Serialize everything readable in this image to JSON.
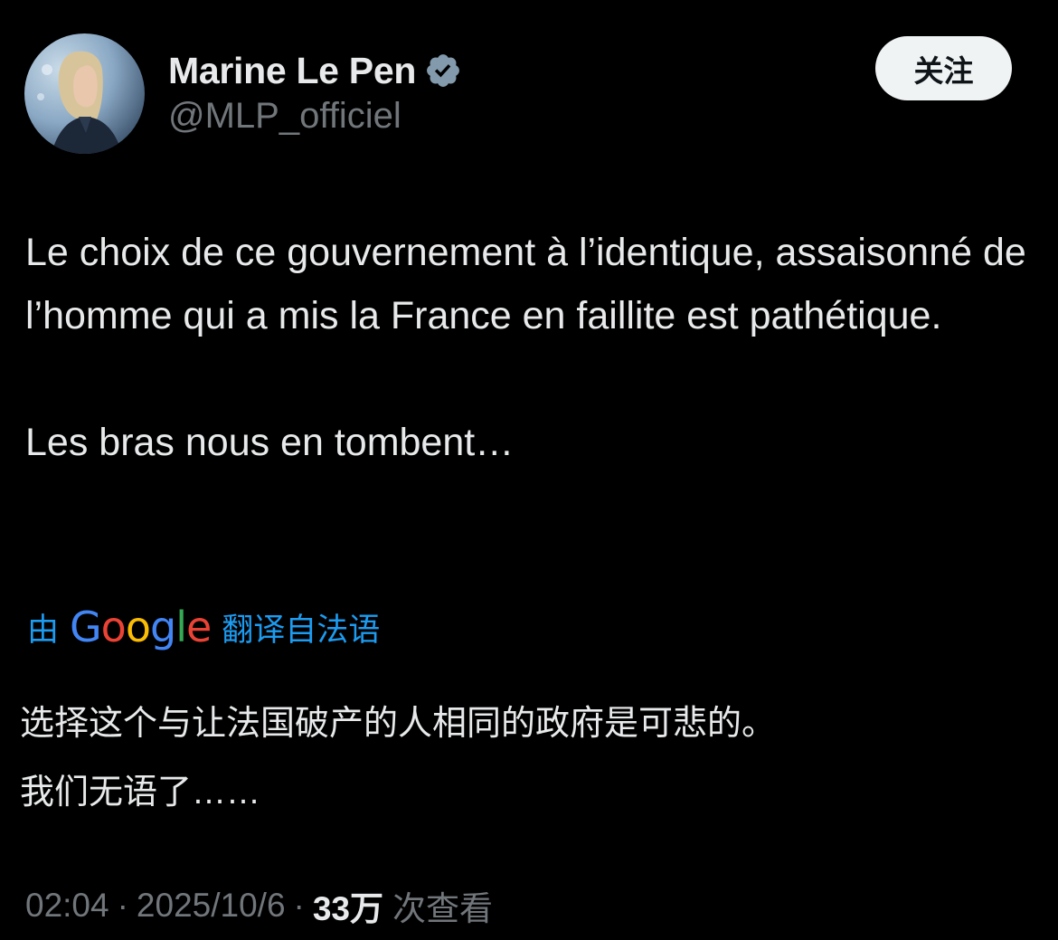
{
  "author": {
    "display_name": "Marine Le Pen",
    "handle": "@MLP_officiel",
    "verified_icon": "verified-badge-icon",
    "verified_color": "#829aab"
  },
  "follow_button": {
    "label": "关注"
  },
  "tweet": {
    "paragraphs": [
      "Le choix de ce gouvernement à l’identique, assaisonné de l’homme qui a mis la France en faillite est pathétique.",
      "Les bras nous en tombent…"
    ]
  },
  "translation": {
    "prefix": "由",
    "provider": "Google",
    "suffix": "翻译自法语",
    "lines": [
      "选择这个与让法国破产的人相同的政府是可悲的。",
      "我们无语了……"
    ]
  },
  "meta": {
    "time": "02:04",
    "separator": "·",
    "date": "2025/10/6",
    "views_count": "33万",
    "views_label": "次查看"
  },
  "colors": {
    "background": "#000000",
    "text_primary": "#e7e9ea",
    "text_secondary": "#71767b",
    "link_blue": "#1d9bf0",
    "button_bg": "#eff3f4"
  }
}
